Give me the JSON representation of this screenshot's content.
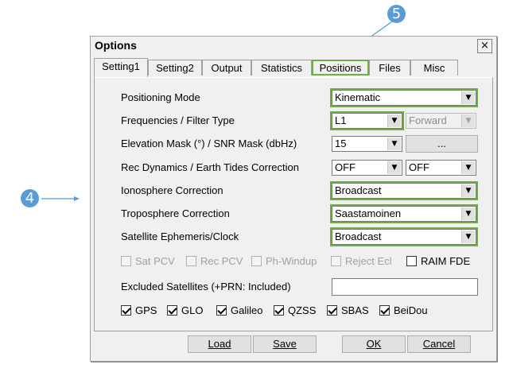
{
  "callouts": {
    "left": "4",
    "top": "5"
  },
  "window": {
    "title": "Options",
    "close_glyph": "×",
    "close_icon": "close-icon"
  },
  "tabs": [
    {
      "label": "Setting1"
    },
    {
      "label": "Setting2"
    },
    {
      "label": "Output"
    },
    {
      "label": "Statistics"
    },
    {
      "label": "Positions"
    },
    {
      "label": "Files"
    },
    {
      "label": "Misc"
    }
  ],
  "rows": {
    "positioning_mode": {
      "label": "Positioning Mode",
      "value": "Kinematic"
    },
    "freq_filter": {
      "label": "Frequencies / Filter Type",
      "freq": "L1",
      "filter": "Forward"
    },
    "elev_snr": {
      "label": "Elevation Mask (°) / SNR Mask (dbHz)",
      "elev": "15",
      "snr_button": "..."
    },
    "dynamics_tides": {
      "label": "Rec Dynamics / Earth Tides Correction",
      "dynamics": "OFF",
      "tides": "OFF"
    },
    "ionosphere": {
      "label": "Ionosphere Correction",
      "value": "Broadcast"
    },
    "troposphere": {
      "label": "Troposphere Correction",
      "value": "Saastamoinen"
    },
    "ephemeris": {
      "label": "Satellite Ephemeris/Clock",
      "value": "Broadcast"
    }
  },
  "options_checks": [
    {
      "label": "Sat PCV",
      "checked": false,
      "enabled": false
    },
    {
      "label": "Rec PCV",
      "checked": false,
      "enabled": false
    },
    {
      "label": "Ph-Windup",
      "checked": false,
      "enabled": false
    },
    {
      "label": "Reject Ecl",
      "checked": false,
      "enabled": false
    },
    {
      "label": "RAIM FDE",
      "checked": false,
      "enabled": true
    }
  ],
  "excluded": {
    "label": "Excluded Satellites (+PRN: Included)",
    "value": ""
  },
  "systems": [
    {
      "label": "GPS",
      "checked": true
    },
    {
      "label": "GLO",
      "checked": true
    },
    {
      "label": "Galileo",
      "checked": true
    },
    {
      "label": "QZSS",
      "checked": true
    },
    {
      "label": "SBAS",
      "checked": true
    },
    {
      "label": "BeiDou",
      "checked": true
    }
  ],
  "buttons": {
    "load": "Load",
    "save": "Save",
    "ok": "OK",
    "cancel": "Cancel"
  },
  "colors": {
    "highlight": "#70ad47",
    "callout": "#5b9bd5"
  }
}
